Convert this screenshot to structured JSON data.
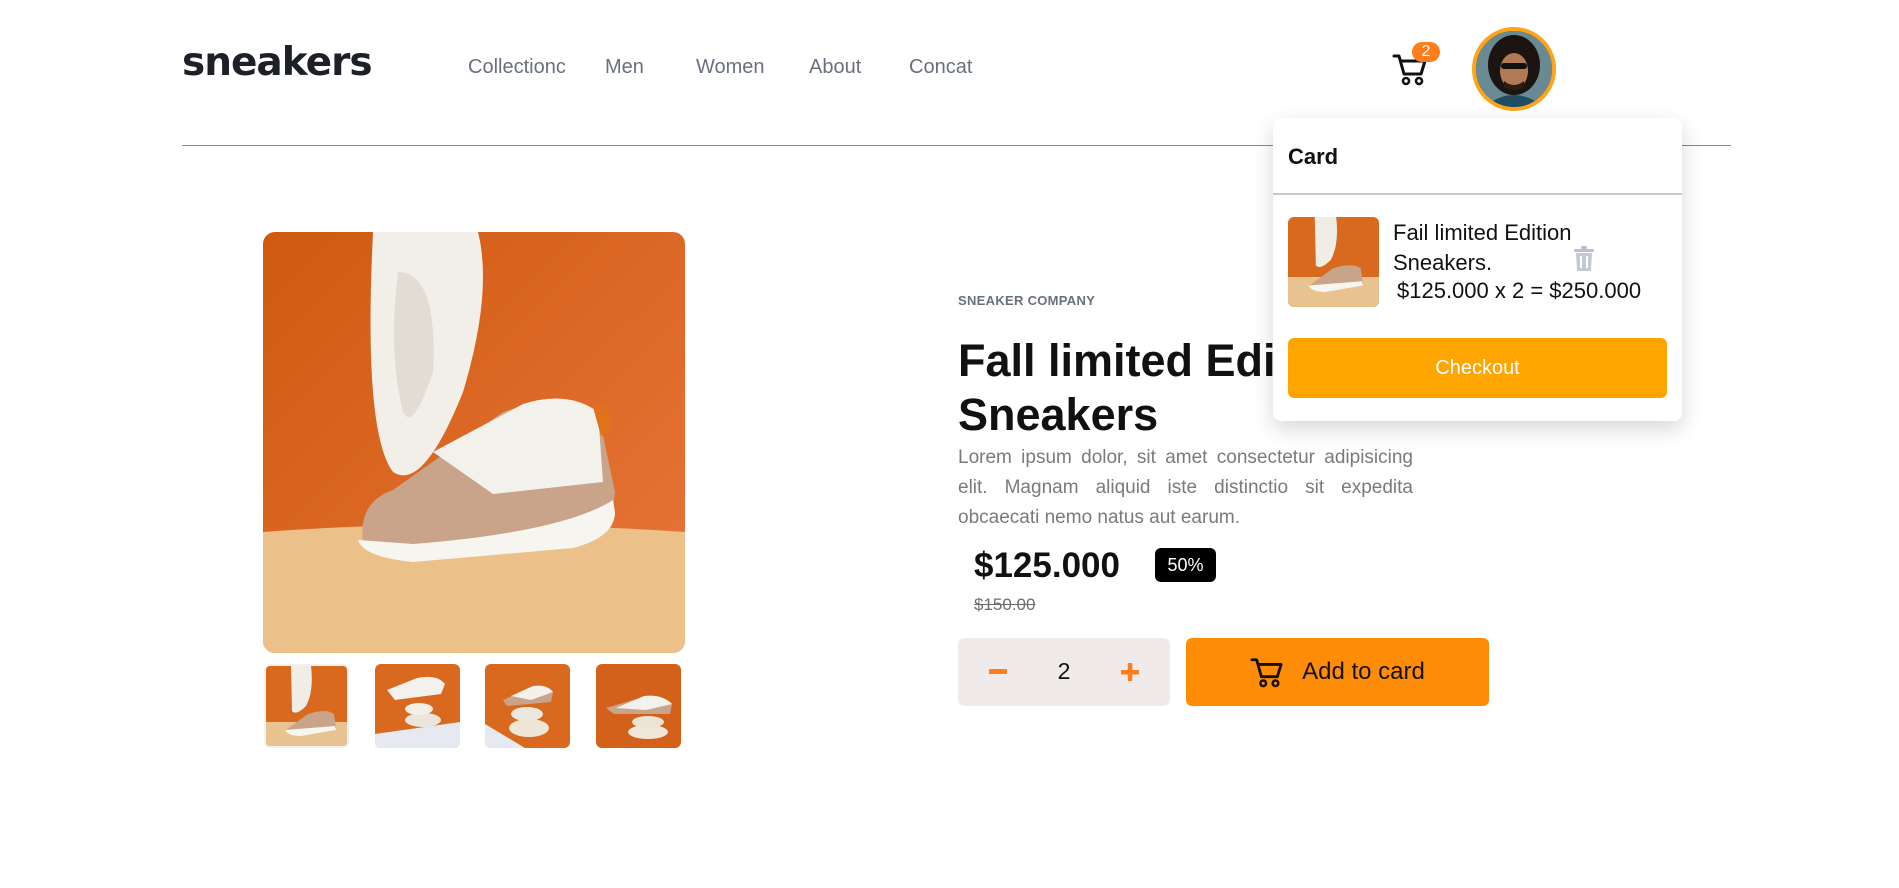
{
  "brand": {
    "logo_text": "sneakers"
  },
  "nav": {
    "items": [
      "Collectionc",
      "Men",
      "Women",
      "About",
      "Concat"
    ]
  },
  "header": {
    "cart_count": "2",
    "cart_icon": "cart-icon",
    "avatar_icon": "user-avatar"
  },
  "product": {
    "company": "SNEAKER COMPANY",
    "title": "Fall limited Edition Sneakers",
    "description": "Lorem ipsum dolor, sit amet consectetur adipisicing elit. Magnam aliquid iste distinctio sit expedita obcaecati nemo natus aut earum.",
    "price": "$125.000",
    "discount": "50%",
    "old_price": "$150.00",
    "quantity": "2",
    "add_to_cart_label": "Add to card",
    "thumbnail_count": 4
  },
  "cart_panel": {
    "title": "Card",
    "item_name": "Fail limited Edition Sneakers.",
    "item_total": "$125.000 x 2 = $250.000",
    "checkout_label": "Checkout"
  },
  "colors": {
    "accent": "#ff8c07",
    "checkout": "#ffa500",
    "badge": "#ff7e1b",
    "avatar_ring": "#ffa31a"
  }
}
